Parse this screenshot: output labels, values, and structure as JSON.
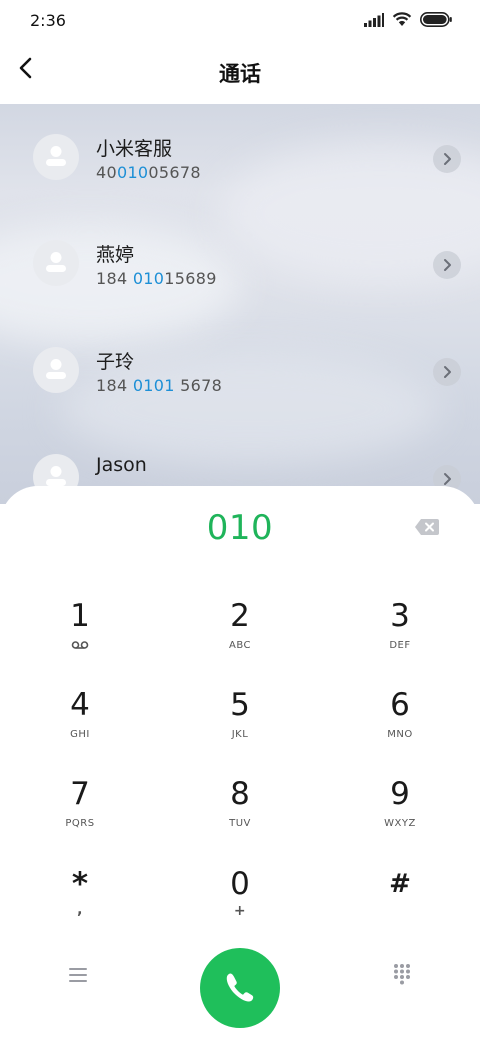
{
  "status": {
    "time": "2:36"
  },
  "header": {
    "title": "通话"
  },
  "contacts": [
    {
      "name": "小米客服",
      "num_pre": "40",
      "num_hl": "010",
      "num_post": "05678"
    },
    {
      "name": "燕婷",
      "num_pre": "184 ",
      "num_hl": "010",
      "num_post": "15689"
    },
    {
      "name": "子玲",
      "num_pre": "184 ",
      "num_hl": "0101",
      "num_post": " 5678"
    },
    {
      "name": "Jason",
      "num_pre": "",
      "num_hl": "",
      "num_post": ""
    }
  ],
  "dialpad": {
    "input": "010",
    "keys": [
      {
        "num": "1",
        "sub": ""
      },
      {
        "num": "2",
        "sub": "ABC"
      },
      {
        "num": "3",
        "sub": "DEF"
      },
      {
        "num": "4",
        "sub": "GHI"
      },
      {
        "num": "5",
        "sub": "JKL"
      },
      {
        "num": "6",
        "sub": "MNO"
      },
      {
        "num": "7",
        "sub": "PQRS"
      },
      {
        "num": "8",
        "sub": "TUV"
      },
      {
        "num": "9",
        "sub": "WXYZ"
      },
      {
        "num": "*",
        "sub": ","
      },
      {
        "num": "0",
        "sub": "+"
      },
      {
        "num": "#",
        "sub": ""
      }
    ]
  },
  "colors": {
    "accent_green": "#1fbf5b",
    "highlight_blue": "#1d8fd6"
  },
  "icons": {
    "back": "chevron-left-icon",
    "backspace": "backspace-icon",
    "voicemail": "voicemail-icon",
    "call": "phone-icon",
    "menu": "menu-icon",
    "keypad": "keypad-icon"
  }
}
